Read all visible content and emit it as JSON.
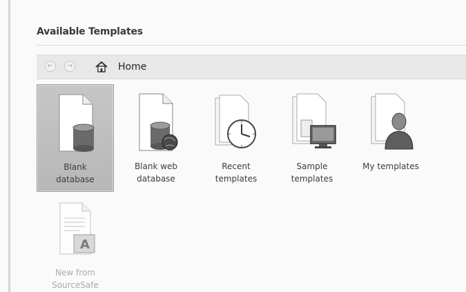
{
  "header": {
    "title": "Available Templates"
  },
  "nav": {
    "home_label": "Home"
  },
  "templates": [
    {
      "label": "Blank\ndatabase",
      "icon": "blank-database-icon",
      "selected": true
    },
    {
      "label": "Blank web\ndatabase",
      "icon": "blank-web-database-icon",
      "selected": false
    },
    {
      "label": "Recent\ntemplates",
      "icon": "recent-templates-icon",
      "selected": false
    },
    {
      "label": "Sample\ntemplates",
      "icon": "sample-templates-icon",
      "selected": false
    },
    {
      "label": "My templates",
      "icon": "my-templates-icon",
      "selected": false
    },
    {
      "label": "New from\nSourceSafe",
      "icon": "sourcesafe-icon",
      "selected": false,
      "disabled": true
    }
  ]
}
